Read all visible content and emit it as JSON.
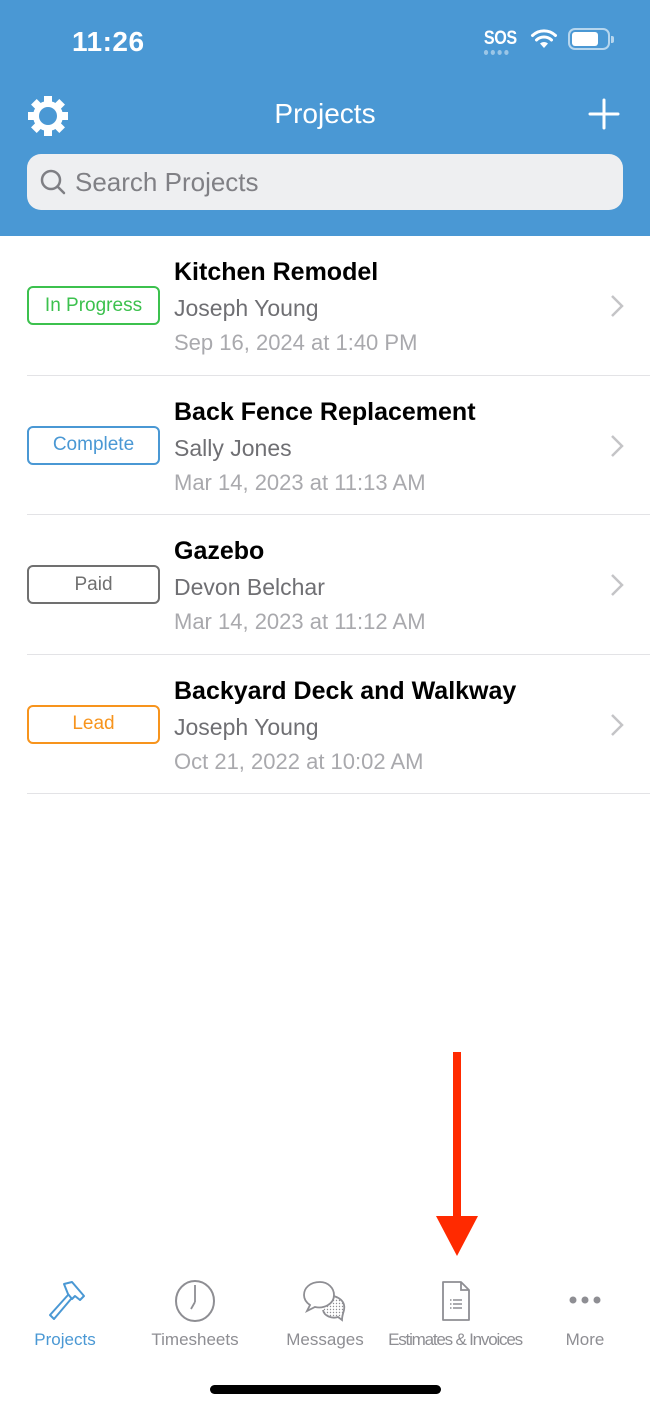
{
  "status_bar": {
    "time": "11:26",
    "sos_label": "SOS",
    "wifi_icon": "wifi-icon",
    "battery_icon": "battery-icon"
  },
  "nav": {
    "title": "Projects",
    "settings_icon": "gear-icon",
    "add_icon": "plus-icon"
  },
  "search": {
    "placeholder": "Search Projects",
    "value": "",
    "icon": "search-icon"
  },
  "projects": [
    {
      "status": "In Progress",
      "status_color": "#3cc14e",
      "title": "Kitchen Remodel",
      "client": "Joseph Young",
      "date": "Sep 16, 2024 at 1:40 PM"
    },
    {
      "status": "Complete",
      "status_color": "#4a98d4",
      "title": "Back Fence Replacement",
      "client": "Sally Jones",
      "date": "Mar 14, 2023 at 11:13 AM"
    },
    {
      "status": "Paid",
      "status_color": "#707070",
      "title": "Gazebo",
      "client": "Devon Belchar",
      "date": "Mar 14, 2023 at 11:12 AM"
    },
    {
      "status": "Lead",
      "status_color": "#f7941d",
      "title": "Backyard Deck and Walkway",
      "client": "Joseph Young",
      "date": "Oct 21, 2022 at 10:02 AM"
    }
  ],
  "annotation": {
    "arrow_icon": "red-down-arrow",
    "color": "#ff2a00"
  },
  "tab_bar": {
    "active_color": "#4a98d4",
    "inactive_color": "#8e8e93",
    "tabs": [
      {
        "label": "Projects",
        "icon": "hammer-icon",
        "active": true
      },
      {
        "label": "Timesheets",
        "icon": "clock-icon",
        "active": false
      },
      {
        "label": "Messages",
        "icon": "chat-bubbles-icon",
        "active": false
      },
      {
        "label": "Estimates & Invoices",
        "icon": "document-icon",
        "active": false
      },
      {
        "label": "More",
        "icon": "more-dots-icon",
        "active": false
      }
    ]
  }
}
